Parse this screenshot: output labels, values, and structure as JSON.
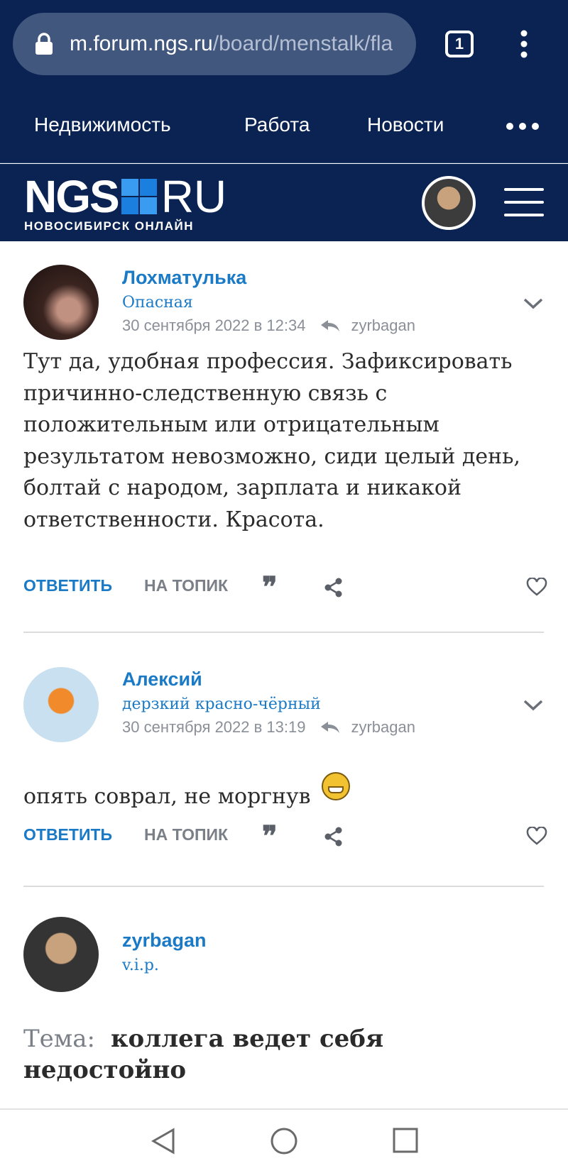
{
  "browser": {
    "url_domain": "m.forum.ngs.ru",
    "url_path": "/board/menstalk/fla",
    "tab_count": "1"
  },
  "site_nav": {
    "items": [
      "Недвижимость",
      "Работа",
      "Новости"
    ]
  },
  "logo": {
    "ngs": "NGS",
    "ru": "RU",
    "subtitle": "НОВОСИБИРСК ОНЛАЙН"
  },
  "posts": [
    {
      "author": "Лохматулька",
      "rank": "Опасная",
      "date": "30 сентября 2022 в 12:34",
      "reply_to": "zyrbagan",
      "text": "Тут да, удобная профессия. Зафиксировать причинно-следственную связь с положительным или отрицательным результатом невозможно, сиди целый день, болтай с народом, зарплата и никакой ответственности. Красота."
    },
    {
      "author": "Алексий",
      "rank": "дерзкий красно-чёрный",
      "date": "30 сентября 2022 в 13:19",
      "reply_to": "zyrbagan",
      "text": "опять соврал, не моргнув",
      "emoji": "😁"
    }
  ],
  "actions": {
    "reply": "ОТВЕТИТЬ",
    "to_topic": "НА ТОПИК",
    "quote": "❞"
  },
  "op": {
    "author": "zyrbagan",
    "rank": "v.i.p.",
    "topic_label": "Тема:",
    "topic_title": "коллега ведет себя недостойно"
  },
  "colors": {
    "header_bg": "#0a2352",
    "link_blue": "#1a7ac6"
  }
}
